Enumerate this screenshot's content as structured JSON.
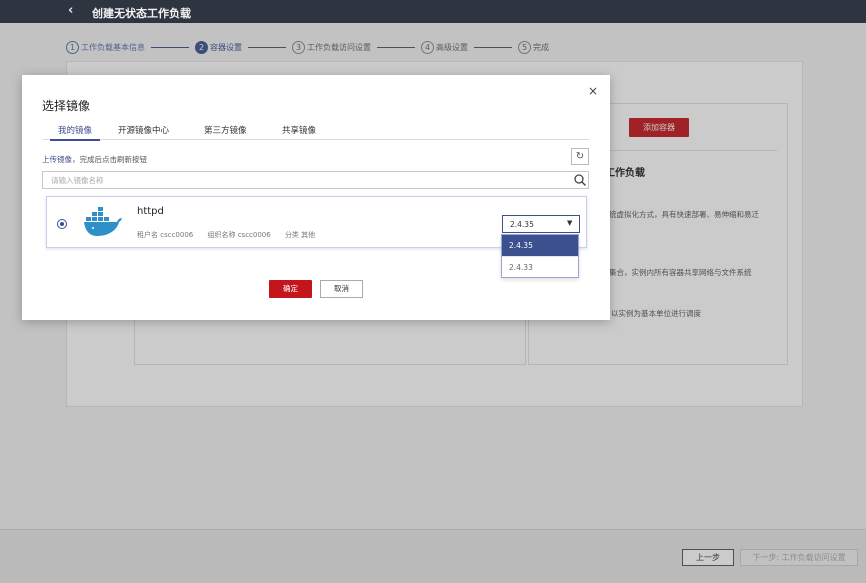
{
  "topbar": {
    "back": "‹",
    "title": "创建无状态工作负载"
  },
  "steps": [
    {
      "num": "1",
      "label": "工作负载基本信息"
    },
    {
      "num": "2",
      "label": "容器设置"
    },
    {
      "num": "3",
      "label": "工作负载访问设置"
    },
    {
      "num": "4",
      "label": "高级设置"
    },
    {
      "num": "5",
      "label": "完成"
    }
  ],
  "right_panel": {
    "add_container": "添加容器",
    "heading": "工作负载",
    "text1": "统虚拟化方式，具有快速部署、易伸缩和易迁",
    "text2": "集合，实例内所有容器共享网络与文件系统",
    "text3": "以实例为基本单位进行调度"
  },
  "bottom": {
    "prev": "上一步",
    "next": "下一步: 工作负载访问设置"
  },
  "modal": {
    "close": "×",
    "title": "选择镜像",
    "tabs": [
      "我的镜像",
      "开源镜像中心",
      "第三方镜像",
      "共享镜像"
    ],
    "upload_link": "上传镜像",
    "upload_text": "，完成后点击刷新按钮",
    "refresh": "↻",
    "search_placeholder": "请输入镜像名称",
    "image": {
      "name": "httpd",
      "tenant": "租户名 cscc0006",
      "org": "组织名称 cscc0006",
      "category": "分类 其他"
    },
    "version_selected": "2.4.35",
    "version_arrow": "▼",
    "versions": [
      "2.4.35",
      "2.4.33"
    ],
    "ok": "确定",
    "cancel": "取消"
  }
}
